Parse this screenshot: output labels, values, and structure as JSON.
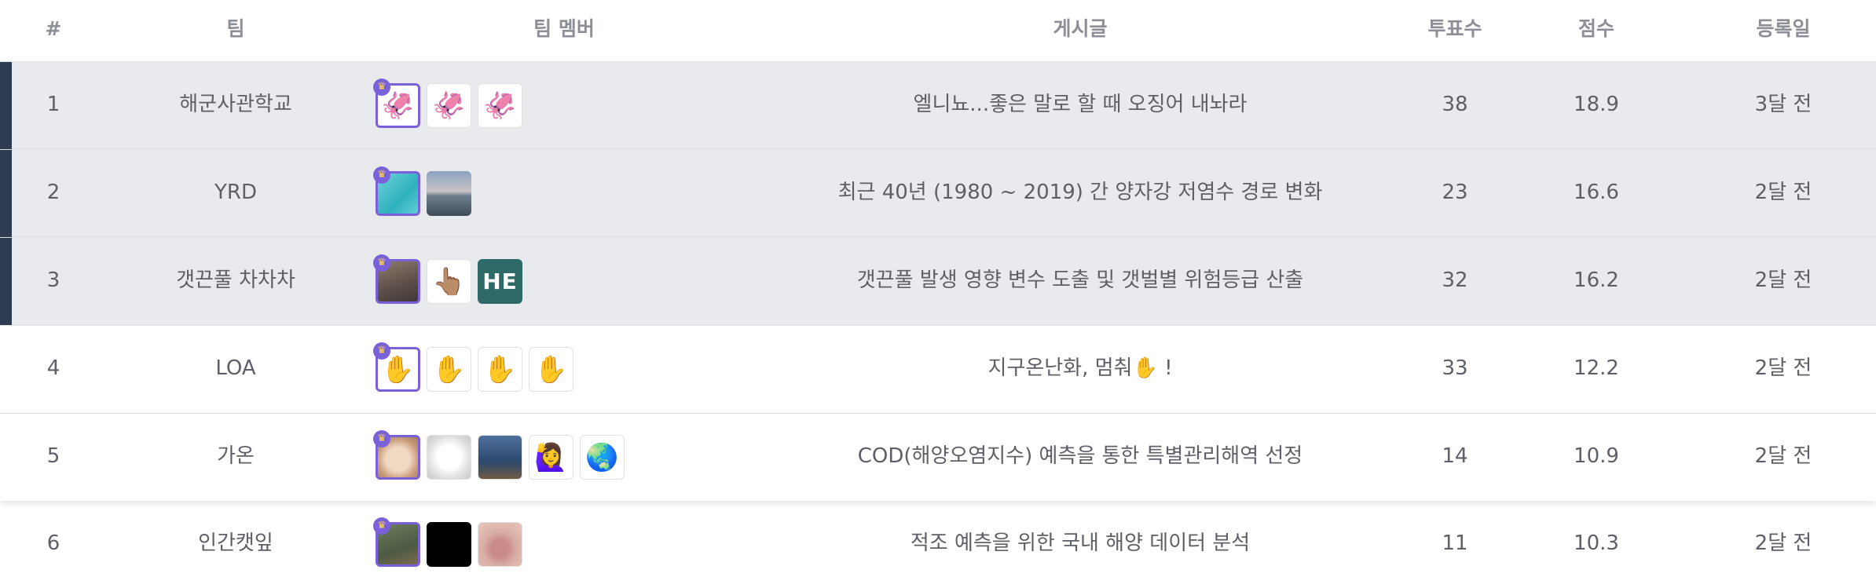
{
  "columns": {
    "rank": "#",
    "team": "팀",
    "members": "팀 멤버",
    "post": "게시글",
    "votes": "투표수",
    "score": "점수",
    "date": "등록일"
  },
  "rows": [
    {
      "rank": "1",
      "team": "해군사관학교",
      "post": "엘니뇨...좋은 말로 할 때 오징어 내놔라",
      "votes": "38",
      "score": "18.9",
      "date": "3달 전",
      "members": [
        {
          "icon": "squid-avatar",
          "glyph": "🦑"
        },
        {
          "icon": "squid-avatar",
          "glyph": "🦑"
        },
        {
          "icon": "squid-avatar",
          "glyph": "🦑"
        }
      ]
    },
    {
      "rank": "2",
      "team": "YRD",
      "post": "최근 40년 (1980 ~ 2019) 간 양자강 저염수 경로 변화",
      "votes": "23",
      "score": "16.6",
      "date": "2달 전",
      "members": [
        {
          "icon": "sea-water-avatar"
        },
        {
          "icon": "sea-horizon-avatar"
        }
      ]
    },
    {
      "rank": "3",
      "team": "갯끈풀 차차차",
      "post": "갯끈풀 발생 영향 변수 도출 및 갯벌별 위험등급 산출",
      "votes": "32",
      "score": "16.2",
      "date": "2달 전",
      "members": [
        {
          "icon": "person-photo-avatar"
        },
        {
          "icon": "person-pointing-up-avatar",
          "glyph": "👆🏽"
        },
        {
          "icon": "initials-avatar",
          "text": "HE"
        }
      ]
    },
    {
      "rank": "4",
      "team": "LOA",
      "post": "지구온난화, 멈춰✋ !",
      "votes": "33",
      "score": "12.2",
      "date": "2달 전",
      "members": [
        {
          "icon": "raised-hand-avatar",
          "glyph": "✋"
        },
        {
          "icon": "raised-hand-avatar",
          "glyph": "✋"
        },
        {
          "icon": "raised-hand-avatar",
          "glyph": "✋"
        },
        {
          "icon": "raised-hand-avatar",
          "glyph": "✋"
        }
      ]
    },
    {
      "rank": "5",
      "team": "가온",
      "post": "COD(해양오염지수) 예측을 통한 특별관리해역 선정",
      "votes": "14",
      "score": "10.9",
      "date": "2달 전",
      "members": [
        {
          "icon": "kitten-avatar"
        },
        {
          "icon": "white-dog-avatar"
        },
        {
          "icon": "otter-avatar"
        },
        {
          "icon": "woman-raising-hand-avatar",
          "glyph": "🙋‍♀️"
        },
        {
          "icon": "earth-avatar",
          "glyph": "🌏"
        }
      ]
    },
    {
      "rank": "6",
      "team": "인간캣잎",
      "post": "적조 예측을 위한 국내 해양 데이터 분석",
      "votes": "11",
      "score": "10.3",
      "date": "2달 전",
      "members": [
        {
          "icon": "capybara-avatar"
        },
        {
          "icon": "black-avatar"
        },
        {
          "icon": "lips-photo-avatar"
        }
      ]
    }
  ],
  "colors": {
    "leader_border": "#7b61d9",
    "top_row_bg": "#e9eaed",
    "top_row_marker": "#2c3a52"
  }
}
